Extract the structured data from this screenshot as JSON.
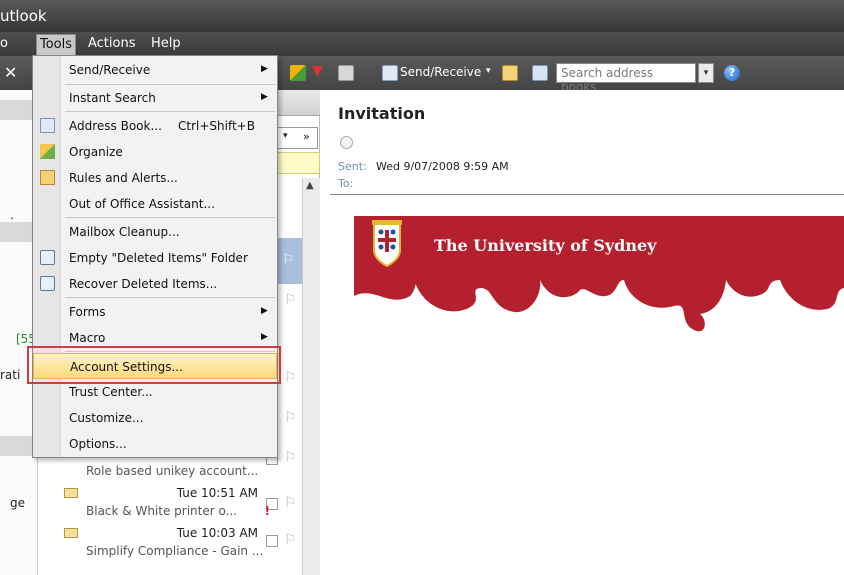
{
  "window": {
    "title": "Outlook",
    "title_visible": "utlook"
  },
  "menubar": {
    "items": [
      {
        "label": "o"
      },
      {
        "label": "Tools"
      },
      {
        "label": "Actions"
      },
      {
        "label": "Help"
      }
    ]
  },
  "toolbar": {
    "close_glyph": "✕",
    "send_receive": "Send/Receive",
    "search_placeholder": "Search address books",
    "dropdown_arrow": "▾",
    "help_glyph": "?"
  },
  "tools_menu": {
    "items": [
      {
        "label": "Send/Receive",
        "submenu": true
      },
      {
        "label": "Instant Search",
        "submenu": true
      },
      {
        "label": "Address Book...",
        "shortcut": "Ctrl+Shift+B",
        "icon": "address-book-icon"
      },
      {
        "label": "Organize",
        "icon": "organize-icon"
      },
      {
        "label": "Rules and Alerts...",
        "icon": "rules-icon"
      },
      {
        "label": "Out of Office Assistant..."
      },
      {
        "label": "Mailbox Cleanup..."
      },
      {
        "label": "Empty \"Deleted Items\" Folder",
        "icon": "empty-deleted-icon"
      },
      {
        "label": "Recover Deleted Items...",
        "icon": "recover-icon"
      },
      {
        "label": "Forms",
        "submenu": true
      },
      {
        "label": "Macro",
        "submenu": true
      },
      {
        "label": "Account Settings...",
        "highlighted": true
      },
      {
        "label": "Trust Center..."
      },
      {
        "label": "Customize..."
      },
      {
        "label": "Options..."
      }
    ],
    "submenu_arrow": "▶"
  },
  "navpane": {
    "fragments": [
      "[55",
      "rati",
      "ge",
      "."
    ]
  },
  "maillist": {
    "items": [
      {
        "time": "",
        "subject": "Role based unikey account..."
      },
      {
        "time": "Tue 10:51 AM",
        "subject": "Black & White printer o...",
        "important": "!"
      },
      {
        "time": "Tue 10:03 AM",
        "subject": "Simplify Compliance - Gain ..."
      }
    ],
    "flag_glyph": "⚐",
    "scroll_up": "▲"
  },
  "reading": {
    "subject": "Invitation",
    "sent_label": "Sent:",
    "sent_value": "Wed 9/07/2008 9:59 AM",
    "to_label": "To:",
    "banner_text": "The University of Sydney",
    "brand_color": "#b5202e"
  }
}
